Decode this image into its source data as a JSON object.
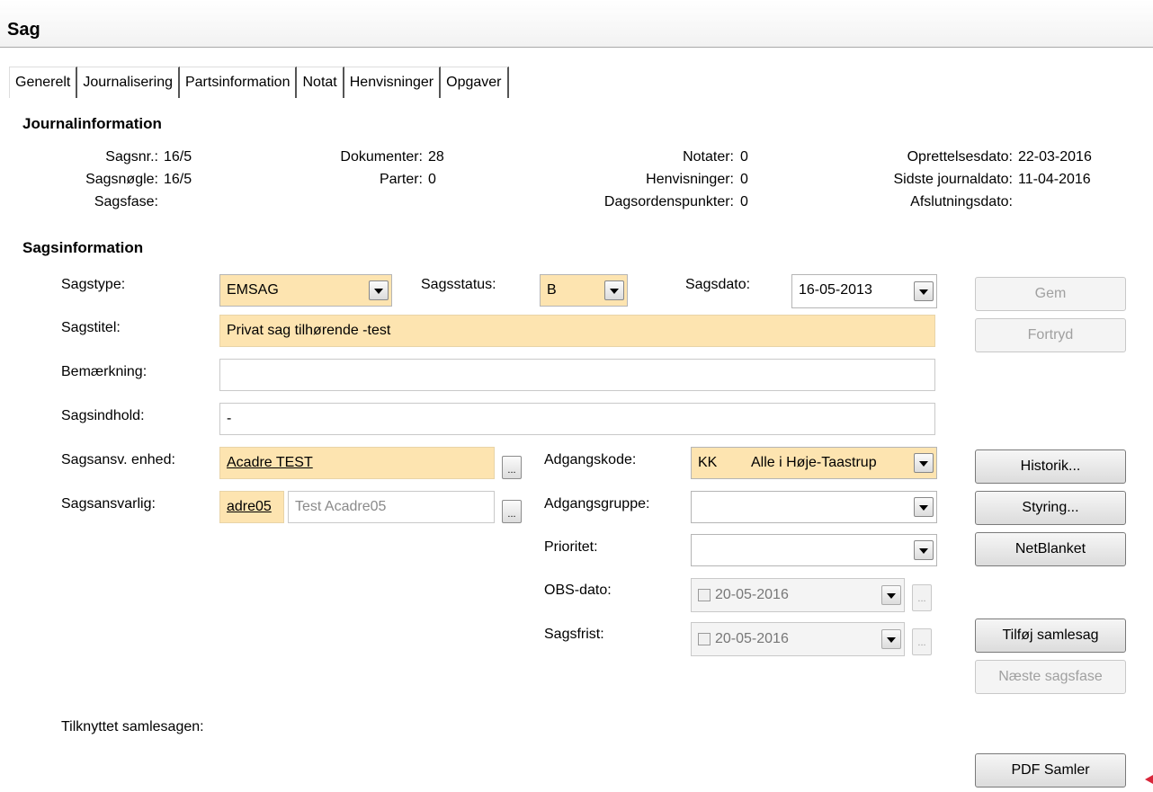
{
  "window": {
    "title": "Sag"
  },
  "tabs": [
    "Generelt",
    "Journalisering",
    "Partsinformation",
    "Notat",
    "Henvisninger",
    "Opgaver"
  ],
  "journal": {
    "title": "Journalinformation",
    "sagsnr_label": "Sagsnr.:",
    "sagsnr_value": "16/5",
    "sagsnoegle_label": "Sagsnøgle:",
    "sagsnoegle_value": "16/5",
    "sagsfase_label": "Sagsfase:",
    "dokumenter_label": "Dokumenter:",
    "dokumenter_value": "28",
    "parter_label": "Parter:",
    "parter_value": "0",
    "notater_label": "Notater:",
    "notater_value": "0",
    "henvisninger_label": "Henvisninger:",
    "henvisninger_value": "0",
    "dagsorden_label": "Dagsordenspunkter:",
    "dagsorden_value": "0",
    "oprettelse_label": "Oprettelsesdato:",
    "oprettelse_value": "22-03-2016",
    "sidste_label": "Sidste journaldato:",
    "sidste_value": "11-04-2016",
    "afslutning_label": "Afslutningsdato:"
  },
  "sag": {
    "title": "Sagsinformation",
    "sagstype_label": "Sagstype:",
    "sagstype_value": "EMSAG",
    "sagsstatus_label": "Sagsstatus:",
    "sagsstatus_value": "B",
    "sagsdato_label": "Sagsdato:",
    "sagsdato_value": "16-05-2013",
    "sagstitel_label": "Sagstitel:",
    "sagstitel_value": "Privat sag tilhørende -test",
    "bemaerkning_label": "Bemærkning:",
    "bemaerkning_value": "",
    "sagsindhold_label": "Sagsindhold:",
    "sagsindhold_value": "-",
    "enhed_label": "Sagsansv. enhed:",
    "enhed_value": "Acadre TEST",
    "ansvarlig_label": "Sagsansvarlig:",
    "ansvarlig_code": "adre05",
    "ansvarlig_name": "Test Acadre05",
    "adgangskode_label": "Adgangskode:",
    "adgangskode_code": "KK",
    "adgangskode_value": "Alle i Høje-Taastrup",
    "adgangsgruppe_label": "Adgangsgruppe:",
    "adgangsgruppe_value": "",
    "prioritet_label": "Prioritet:",
    "prioritet_value": "",
    "obsdato_label": "OBS-dato:",
    "obsdato_value": "20-05-2016",
    "sagsfrist_label": "Sagsfrist:",
    "sagsfrist_value": "20-05-2016",
    "samlesag_label": "Tilknyttet samlesagen:",
    "ellipsis": "..."
  },
  "buttons": {
    "gem": "Gem",
    "fortryd": "Fortryd",
    "historik": "Historik...",
    "styring": "Styring...",
    "netblanket": "NetBlanket",
    "tilfoej": "Tilføj samlesag",
    "naeste": "Næste sagsfase",
    "pdf": "PDF Samler"
  }
}
